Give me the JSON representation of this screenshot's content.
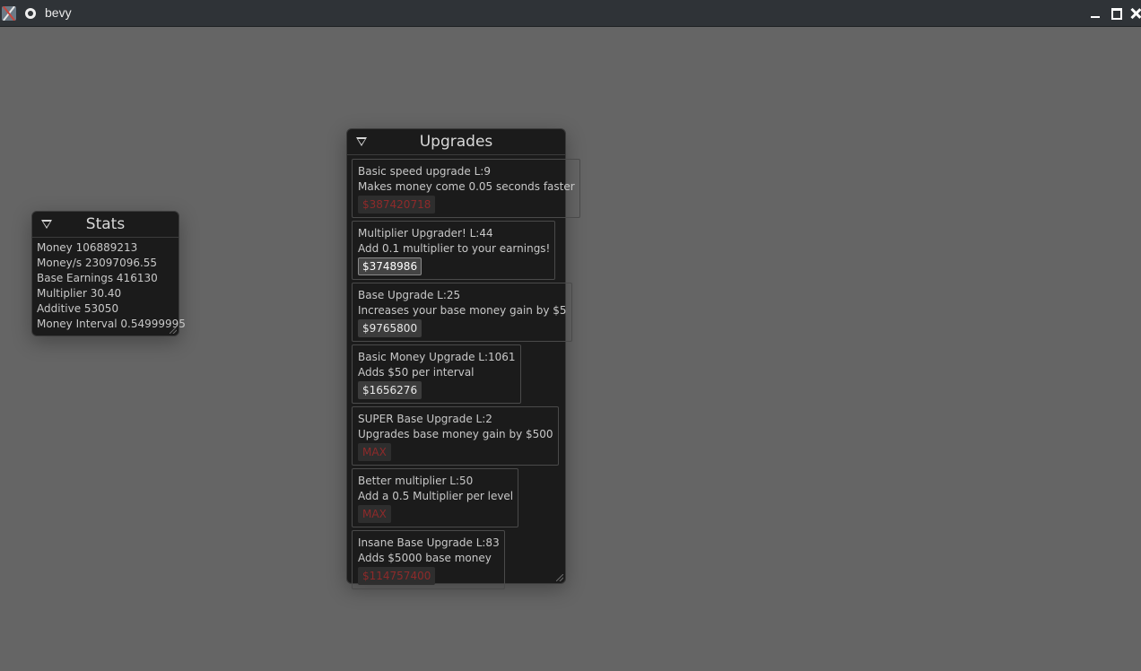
{
  "window": {
    "title": "bevy"
  },
  "stats": {
    "title": "Stats",
    "lines": [
      "Money 106889213",
      "Money/s 23097096.55",
      "Base Earnings 416130",
      "Multiplier 30.40",
      "Additive 53050",
      "Money Interval 0.54999995"
    ]
  },
  "upgrades": {
    "title": "Upgrades",
    "items": [
      {
        "name": "Basic speed upgrade L:9",
        "desc": "Makes money come 0.05 seconds faster",
        "price": "$387420718",
        "state": "disabled"
      },
      {
        "name": "Multiplier Upgrader! L:44",
        "desc": "Add 0.1 multiplier to your earnings!",
        "price": "$3748986",
        "state": "hover"
      },
      {
        "name": "Base Upgrade L:25",
        "desc": "Increases your base money gain by $5",
        "price": "$9765800",
        "state": "enabled"
      },
      {
        "name": "Basic Money Upgrade L:1061",
        "desc": "Adds $50 per interval",
        "price": "$1656276",
        "state": "enabled"
      },
      {
        "name": "SUPER Base Upgrade L:2",
        "desc": "Upgrades base money gain by $500",
        "price": "MAX",
        "state": "disabled"
      },
      {
        "name": "Better multiplier L:50",
        "desc": "Add a 0.5 Multiplier per level",
        "price": "MAX",
        "state": "disabled"
      },
      {
        "name": "Insane Base Upgrade L:83",
        "desc": "Adds $5000 base money",
        "price": "$114757400",
        "state": "disabled"
      }
    ]
  },
  "colors": {
    "background": "#656565",
    "panel": "#1b1b1b",
    "disabled_price": "#8e2a2a"
  }
}
